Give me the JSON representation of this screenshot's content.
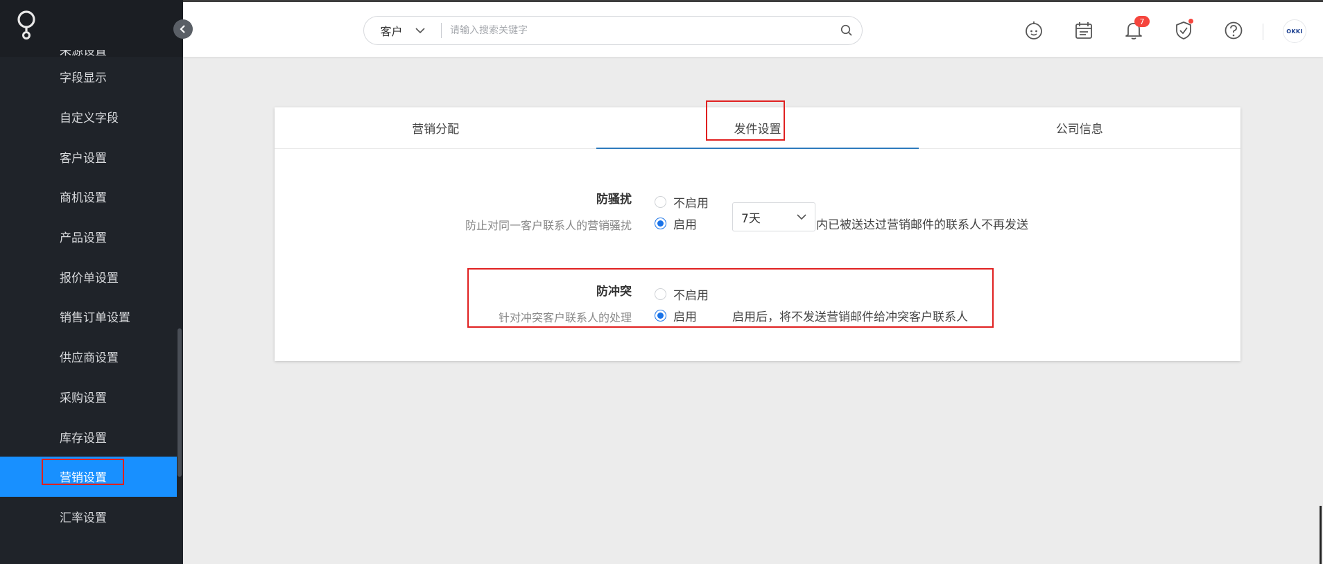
{
  "sidebar": {
    "clipped_item": "来源设置",
    "items": [
      {
        "label": "字段显示"
      },
      {
        "label": "自定义字段"
      },
      {
        "label": "客户设置"
      },
      {
        "label": "商机设置"
      },
      {
        "label": "产品设置"
      },
      {
        "label": "报价单设置"
      },
      {
        "label": "销售订单设置"
      },
      {
        "label": "供应商设置"
      },
      {
        "label": "采购设置"
      },
      {
        "label": "库存设置"
      },
      {
        "label": "营销设置"
      },
      {
        "label": "汇率设置"
      }
    ],
    "active_index": 10
  },
  "header": {
    "search_scope": "客户",
    "search_placeholder": "请输入搜索关键字",
    "notification_count": "7",
    "avatar_text": "OKKI"
  },
  "tabs": [
    {
      "label": "营销分配"
    },
    {
      "label": "发件设置"
    },
    {
      "label": "公司信息"
    }
  ],
  "active_tab": 1,
  "anti_harassment": {
    "title": "防骚扰",
    "desc": "防止对同一客户联系人的营销骚扰",
    "option_off": "不启用",
    "option_on": "启用",
    "selected": "on",
    "period": "7天",
    "suffix": "内已被送达过营销邮件的联系人不再发送"
  },
  "anti_conflict": {
    "title": "防冲突",
    "desc": "针对冲突客户联系人的处理",
    "option_off": "不启用",
    "option_on": "启用",
    "selected": "on",
    "note": "启用后，将不发送营销邮件给冲突客户联系人"
  },
  "colors": {
    "sidebar_bg": "#1f2329",
    "active_bg": "#1890ff",
    "highlight": "#e02020",
    "radio_on": "#1a73e8",
    "badge": "#f5453d"
  }
}
